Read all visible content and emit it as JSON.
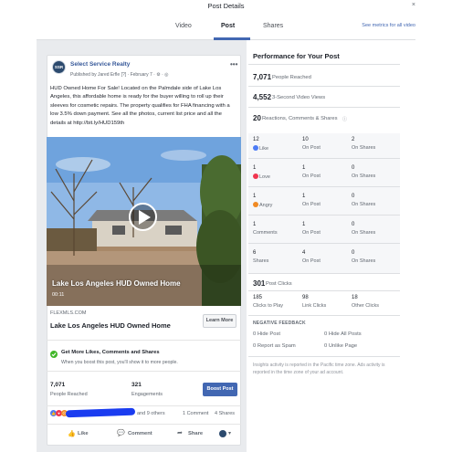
{
  "window": {
    "title": "Post Details",
    "close": "×"
  },
  "tabs": {
    "video": "Video",
    "post": "Post",
    "shares": "Shares",
    "metrics_link": "See metrics for all video"
  },
  "post": {
    "avatar_text": "SSR",
    "page_name": "Select Service Realty",
    "published_by": "Published by Jared Erfle [?] · February 7 · ⚙ · ◎",
    "text": "HUD Owned Home For Sale! Located on the Palmdale side of Lake Los Angeles, this affordable home is ready for the buyer willing to roll up their sleeves for cosmetic repairs. The property qualifies for FHA financing with a low 3.5% down payment. See all the photos, current list price and all the details at http://bit.ly/HUD159th",
    "video_title": "Lake Los Angeles HUD Owned Home",
    "video_time": "00:11",
    "link_domain": "FLEXMLS.COM",
    "link_title": "Lake Los Angeles HUD Owned Home",
    "learn_more": "Learn More",
    "boost_title": "Get More Likes, Comments and Shares",
    "boost_sub": "When you boost this post, you'll show it to more people.",
    "reached_num": "7,071",
    "reached_lbl": "People Reached",
    "engagements_num": "321",
    "engagements_lbl": "Engagements",
    "boost_button": "Boost Post",
    "and_others": "and 9 others",
    "comments_count": "1 Comment",
    "shares_count": "4 Shares",
    "actions": {
      "like": "Like",
      "comment": "Comment",
      "share": "Share"
    }
  },
  "performance": {
    "title": "Performance for Your Post",
    "people_reached_num": "7,071",
    "people_reached_lbl": "People Reached",
    "views_num": "4,552",
    "views_lbl": "3-Second Video Views",
    "reactions_num": "20",
    "reactions_lbl": "Reactions, Comments & Shares",
    "rows": [
      {
        "n1": "12",
        "l1": "Like",
        "n2": "10",
        "l2": "On Post",
        "n3": "2",
        "l3": "On Shares",
        "icon": "like"
      },
      {
        "n1": "1",
        "l1": "Love",
        "n2": "1",
        "l2": "On Post",
        "n3": "0",
        "l3": "On Shares",
        "icon": "love"
      },
      {
        "n1": "1",
        "l1": "Angry",
        "n2": "1",
        "l2": "On Post",
        "n3": "0",
        "l3": "On Shares",
        "icon": "angry"
      },
      {
        "n1": "1",
        "l1": "Comments",
        "n2": "1",
        "l2": "On Post",
        "n3": "0",
        "l3": "On Shares",
        "icon": ""
      },
      {
        "n1": "6",
        "l1": "Shares",
        "n2": "4",
        "l2": "On Post",
        "n3": "0",
        "l3": "On Shares",
        "icon": ""
      }
    ],
    "post_clicks_num": "301",
    "post_clicks_lbl": "Post Clicks",
    "clicks": [
      {
        "num": "185",
        "lbl": "Clicks to Play"
      },
      {
        "num": "98",
        "lbl": "Link Clicks"
      },
      {
        "num": "18",
        "lbl": "Other Clicks"
      }
    ],
    "negative_head": "NEGATIVE FEEDBACK",
    "negative": [
      {
        "num": "0",
        "lbl": "Hide Post"
      },
      {
        "num": "0",
        "lbl": "Hide All Posts"
      },
      {
        "num": "0",
        "lbl": "Report as Spam"
      },
      {
        "num": "0",
        "lbl": "Unlike Page"
      }
    ],
    "footnote": "Insights activity is reported in the Pacific time zone. Ads activity is reported in the time zone of your ad account."
  },
  "colors": {
    "accent": "#4267b2",
    "link": "#365899",
    "like": "#4c7bf5",
    "love": "#f0354f",
    "angry": "#f08a24",
    "check": "#42b72a"
  }
}
